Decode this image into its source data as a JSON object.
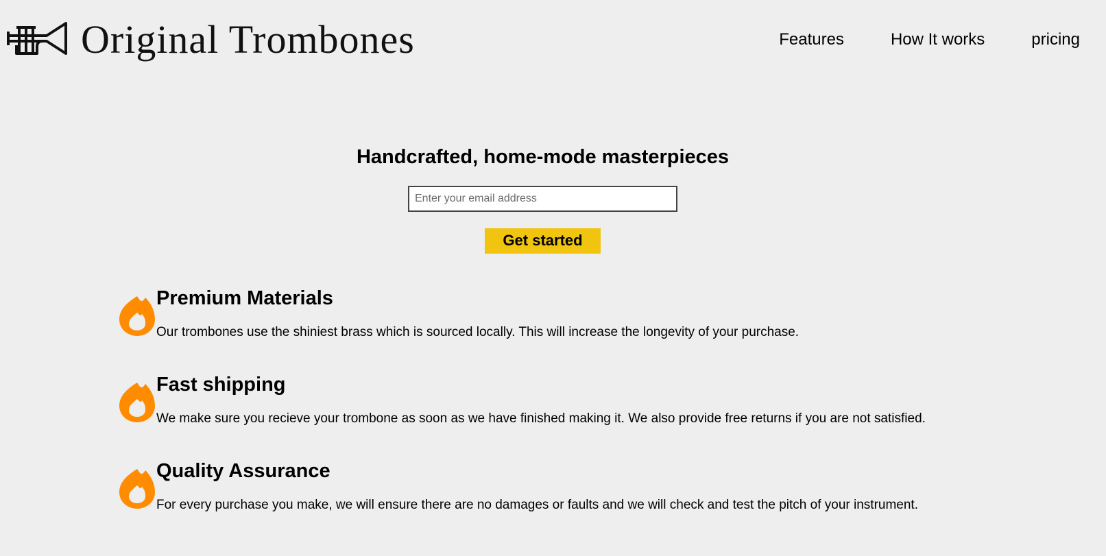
{
  "header": {
    "logo_text": "Original Trombones",
    "logo_icon": "trumpet-icon",
    "nav": [
      {
        "label": "Features"
      },
      {
        "label": "How It works"
      },
      {
        "label": "pricing"
      }
    ]
  },
  "hero": {
    "title": "Handcrafted, home-mode masterpieces",
    "email_placeholder": "Enter your email address",
    "email_value": "",
    "cta_label": "Get started"
  },
  "features": [
    {
      "icon": "flame-icon",
      "title": "Premium Materials",
      "description": "Our trombones use the shiniest brass which is sourced locally. This will increase the longevity of your purchase."
    },
    {
      "icon": "flame-icon",
      "title": "Fast shipping",
      "description": "We make sure you recieve your trombone as soon as we have finished making it. We also provide free returns if you are not satisfied."
    },
    {
      "icon": "flame-icon",
      "title": "Quality Assurance",
      "description": "For every purchase you make, we will ensure there are no damages or faults and we will check and test the pitch of your instrument."
    }
  ],
  "colors": {
    "background": "#eeeeee",
    "accent_button": "#f1c40f",
    "flame": "#ff8c00",
    "text": "#000000"
  }
}
